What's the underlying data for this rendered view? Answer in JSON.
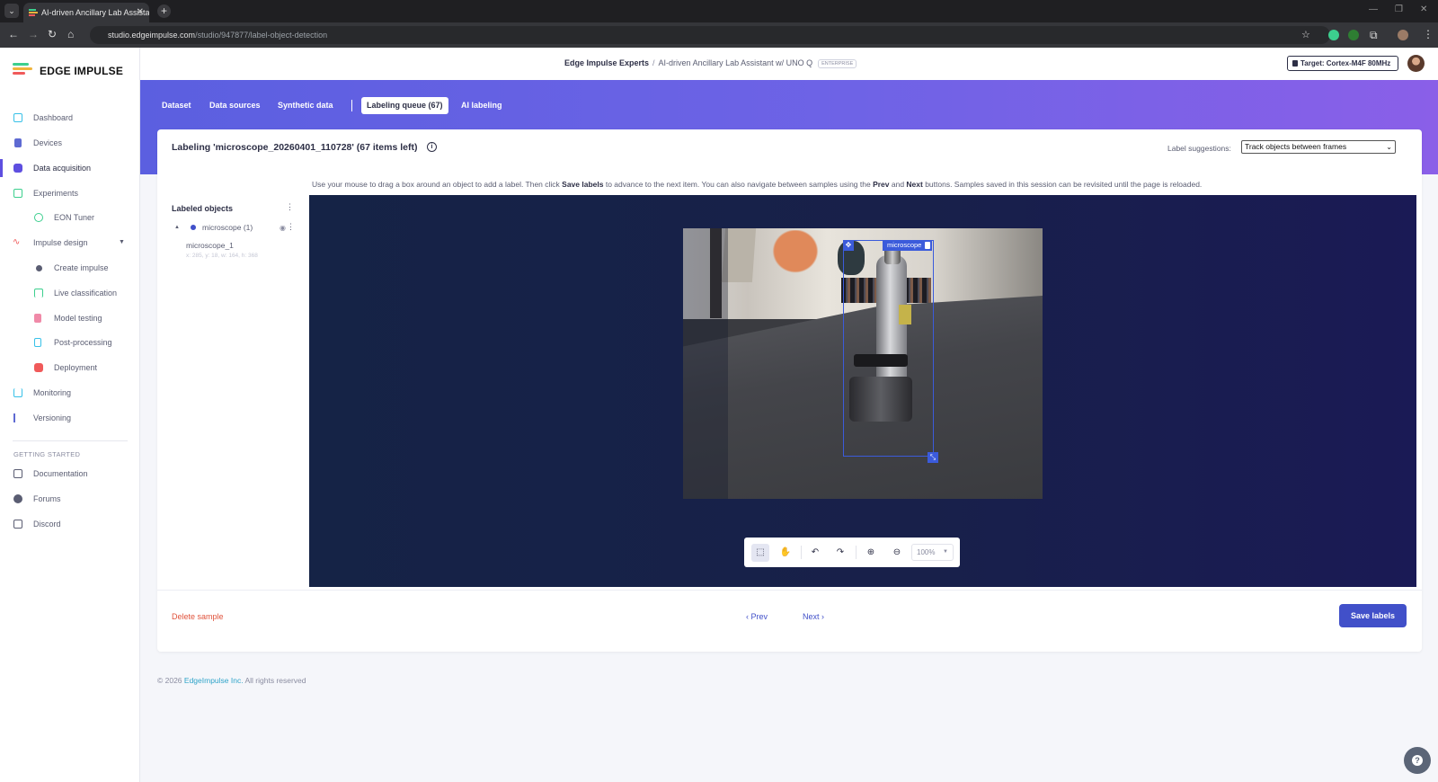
{
  "browser": {
    "tab_title": "AI-driven Ancillary Lab Assistan",
    "tab_close": "✕",
    "new_tab": "+",
    "url_host": "studio.edgeimpulse.com",
    "url_path": "/studio/947877/label-object-detection"
  },
  "sidebar": {
    "brand": "EDGE IMPULSE",
    "items": [
      {
        "label": "Dashboard",
        "icon": "monitor-icon",
        "color": "#38c1e8"
      },
      {
        "label": "Devices",
        "icon": "device-icon",
        "color": "#5e6ad2"
      },
      {
        "label": "Data acquisition",
        "icon": "database-icon",
        "color": "#5e4fe0",
        "active": true
      },
      {
        "label": "Experiments",
        "icon": "table-icon",
        "color": "#3ccf8e"
      },
      {
        "label": "EON Tuner",
        "icon": "gauge-icon",
        "color": "#3ccf8e"
      },
      {
        "label": "Impulse design",
        "icon": "pulse-icon",
        "color": "#f05a5a"
      },
      {
        "label": "Create impulse",
        "icon": "dot-icon",
        "color": "#5a5d72"
      },
      {
        "label": "Live classification",
        "icon": "live-icon",
        "color": "#3ccf8e"
      },
      {
        "label": "Model testing",
        "icon": "testing-icon",
        "color": "#f05a8a"
      },
      {
        "label": "Post-processing",
        "icon": "postproc-icon",
        "color": "#38c1e8"
      },
      {
        "label": "Deployment",
        "icon": "deploy-icon",
        "color": "#f05a5a"
      },
      {
        "label": "Monitoring",
        "icon": "binoculars-icon",
        "color": "#38c1e8"
      },
      {
        "label": "Versioning",
        "icon": "branch-icon",
        "color": "#5e6ad2"
      }
    ],
    "section": "GETTING STARTED",
    "help_items": [
      {
        "label": "Documentation",
        "icon": "book-icon"
      },
      {
        "label": "Forums",
        "icon": "chat-icon"
      },
      {
        "label": "Discord",
        "icon": "discord-icon"
      }
    ]
  },
  "header": {
    "org": "Edge Impulse Experts",
    "separator": "/",
    "project": "AI-driven Ancillary Lab Assistant w/ UNO Q",
    "badge": "ENTERPRISE",
    "target": "Target: Cortex-M4F 80MHz"
  },
  "subtabs": [
    {
      "label": "Dataset"
    },
    {
      "label": "Data sources"
    },
    {
      "label": "Synthetic data"
    },
    {
      "label": "Labeling queue (67)",
      "active": true
    },
    {
      "label": "AI labeling"
    }
  ],
  "labeling": {
    "title": "Labeling 'microscope_20260401_110728' (67 items left)",
    "suggestions_label": "Label suggestions:",
    "suggestions_value": "Track objects between frames",
    "instr_a": "Use your mouse to drag a box around an object to add a label. Then click ",
    "instr_save": "Save labels",
    "instr_b": " to advance to the next item. You can also navigate between samples using the ",
    "instr_prev": "Prev",
    "instr_and": " and ",
    "instr_next": "Next",
    "instr_c": " buttons. Samples saved in this session can be revisited until the page is reloaded.",
    "objects_title": "Labeled objects",
    "group_label": "microscope (1)",
    "object_name": "microscope_1",
    "object_coords": "x: 285, y: 18, w: 164, h: 368",
    "box_label": "microscope",
    "zoom": "100%",
    "delete": "Delete sample",
    "prev": "Prev",
    "next": "Next",
    "save": "Save labels"
  },
  "footer": {
    "copy": "© 2026 ",
    "company": "EdgeImpulse Inc.",
    "rights": " All rights reserved"
  },
  "colors": {
    "accent": "#4150c9",
    "band_start": "#5b5fe0",
    "band_end": "#8a5fe8",
    "danger": "#e0533c",
    "bbox": "#3b5bdb"
  }
}
